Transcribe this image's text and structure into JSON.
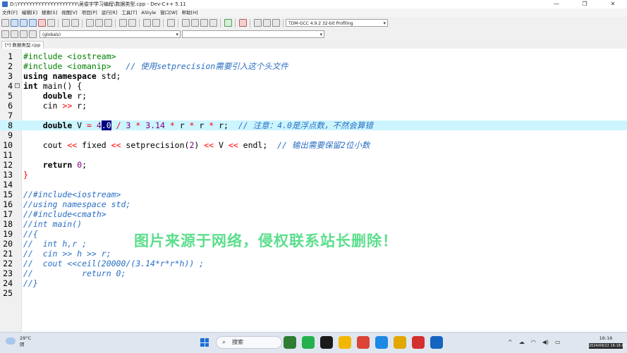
{
  "window": {
    "title": "D:\\YYYYYYYYYYYYYYYYYYYY\\吴俊宇学习编程\\数据类型.cpp - Dev-C++ 5.11",
    "controls": {
      "minimize": "—",
      "restore": "❐",
      "close": "✕"
    }
  },
  "menu": [
    "文件[F]",
    "编辑[E]",
    "搜索[S]",
    "视图[V]",
    "项目[P]",
    "运行[R]",
    "工具[T]",
    "AStyle",
    "窗口[W]",
    "帮助[H]"
  ],
  "toolbar": {
    "compiler_select": "TDM-GCC 4.9.2 32-bit Profiling",
    "scope_select": "(globals)",
    "symbol_select": ""
  },
  "tabs": [
    {
      "label": "[*] 数据类型.cpp",
      "active": true
    }
  ],
  "editor": {
    "current_line": 8,
    "lines": [
      {
        "n": "1",
        "tokens": [
          {
            "t": "#include <iostream>",
            "c": "pp"
          }
        ]
      },
      {
        "n": "2",
        "tokens": [
          {
            "t": "#include <iomanip>",
            "c": "pp"
          },
          {
            "t": "   ",
            "c": "id"
          },
          {
            "t": "// 使用setprecision需要引入这个头文件",
            "c": "cm"
          }
        ]
      },
      {
        "n": "3",
        "tokens": [
          {
            "t": "using namespace",
            "c": "kw"
          },
          {
            "t": " std;",
            "c": "id"
          }
        ]
      },
      {
        "n": "4",
        "fold": "⊟",
        "tokens": [
          {
            "t": "int",
            "c": "ty"
          },
          {
            "t": " main() {",
            "c": "id"
          }
        ]
      },
      {
        "n": "5",
        "tokens": [
          {
            "t": "    ",
            "c": "id"
          },
          {
            "t": "double",
            "c": "ty"
          },
          {
            "t": " r;",
            "c": "id"
          }
        ]
      },
      {
        "n": "6",
        "tokens": [
          {
            "t": "    cin ",
            "c": "id"
          },
          {
            "t": ">>",
            "c": "op"
          },
          {
            "t": " r;",
            "c": "id"
          }
        ]
      },
      {
        "n": "7",
        "tokens": []
      },
      {
        "n": "8",
        "tokens": [
          {
            "t": "    ",
            "c": "id"
          },
          {
            "t": "double",
            "c": "ty"
          },
          {
            "t": " V ",
            "c": "id"
          },
          {
            "t": "=",
            "c": "op"
          },
          {
            "t": " 4",
            "c": "nm"
          },
          {
            "t": ".0",
            "c": "sel"
          },
          {
            "t": " ",
            "c": "id"
          },
          {
            "t": "/",
            "c": "op"
          },
          {
            "t": " 3 ",
            "c": "nm"
          },
          {
            "t": "*",
            "c": "op"
          },
          {
            "t": " 3.14 ",
            "c": "nm"
          },
          {
            "t": "*",
            "c": "op"
          },
          {
            "t": " r ",
            "c": "id"
          },
          {
            "t": "*",
            "c": "op"
          },
          {
            "t": " r ",
            "c": "id"
          },
          {
            "t": "*",
            "c": "op"
          },
          {
            "t": " r;  ",
            "c": "id"
          },
          {
            "t": "// 注意：4.0是浮点数，不然会算错",
            "c": "cm"
          }
        ]
      },
      {
        "n": "9",
        "tokens": []
      },
      {
        "n": "10",
        "tokens": [
          {
            "t": "    cout ",
            "c": "id"
          },
          {
            "t": "<<",
            "c": "op"
          },
          {
            "t": " fixed ",
            "c": "id"
          },
          {
            "t": "<<",
            "c": "op"
          },
          {
            "t": " setprecision(",
            "c": "id"
          },
          {
            "t": "2",
            "c": "nm"
          },
          {
            "t": ") ",
            "c": "id"
          },
          {
            "t": "<<",
            "c": "op"
          },
          {
            "t": " V ",
            "c": "id"
          },
          {
            "t": "<<",
            "c": "op"
          },
          {
            "t": " endl;  ",
            "c": "id"
          },
          {
            "t": "// 输出需要保留2位小数",
            "c": "cm"
          }
        ]
      },
      {
        "n": "11",
        "tokens": []
      },
      {
        "n": "12",
        "tokens": [
          {
            "t": "    ",
            "c": "id"
          },
          {
            "t": "return",
            "c": "kw"
          },
          {
            "t": " ",
            "c": "id"
          },
          {
            "t": "0",
            "c": "nm"
          },
          {
            "t": ";",
            "c": "id"
          }
        ]
      },
      {
        "n": "13",
        "tokens": [
          {
            "t": "}",
            "c": "op"
          }
        ]
      },
      {
        "n": "14",
        "tokens": []
      },
      {
        "n": "15",
        "tokens": [
          {
            "t": "//#include<iostream>",
            "c": "cm"
          }
        ]
      },
      {
        "n": "16",
        "tokens": [
          {
            "t": "//using namespace std;",
            "c": "cm"
          }
        ]
      },
      {
        "n": "17",
        "tokens": [
          {
            "t": "//#include<cmath>",
            "c": "cm"
          }
        ]
      },
      {
        "n": "18",
        "tokens": [
          {
            "t": "//int main()",
            "c": "cm"
          }
        ]
      },
      {
        "n": "19",
        "tokens": [
          {
            "t": "//{",
            "c": "cm"
          }
        ]
      },
      {
        "n": "20",
        "tokens": [
          {
            "t": "//  int h,r ;",
            "c": "cm"
          }
        ]
      },
      {
        "n": "21",
        "tokens": [
          {
            "t": "//  cin >> h >> r;",
            "c": "cm"
          }
        ]
      },
      {
        "n": "22",
        "tokens": [
          {
            "t": "//  cout <<ceil(20000/(3.14*r*r*h)) ;",
            "c": "cm"
          }
        ]
      },
      {
        "n": "23",
        "tokens": [
          {
            "t": "//          return 0;",
            "c": "cm"
          }
        ]
      },
      {
        "n": "24",
        "tokens": [
          {
            "t": "//}",
            "c": "cm"
          }
        ]
      },
      {
        "n": "25",
        "tokens": []
      }
    ]
  },
  "watermark": "图片来源于网络，侵权联系站长删除！",
  "taskbar": {
    "weather_temp": "29°C",
    "weather_desc": "阴",
    "search_icon": "⌕",
    "search_placeholder": "搜索",
    "apps": [
      {
        "name": "file-manager",
        "color": "#2e7d32"
      },
      {
        "name": "wechat",
        "color": "#22b14c"
      },
      {
        "name": "qq",
        "color": "#1a1a1a"
      },
      {
        "name": "explorer",
        "color": "#f2b705"
      },
      {
        "name": "chrome",
        "color": "#db4437"
      },
      {
        "name": "photos",
        "color": "#1e88e5"
      },
      {
        "name": "files",
        "color": "#e0a800"
      },
      {
        "name": "wps",
        "color": "#d32f2f"
      },
      {
        "name": "devcpp",
        "color": "#1565c0"
      }
    ],
    "tray_icons": {
      "chevron": "^",
      "network": "☁",
      "wifi": "◠",
      "volume": "◀)",
      "battery": "▭"
    },
    "time": "16:16",
    "date": "2024/09/22 16:16:03"
  }
}
